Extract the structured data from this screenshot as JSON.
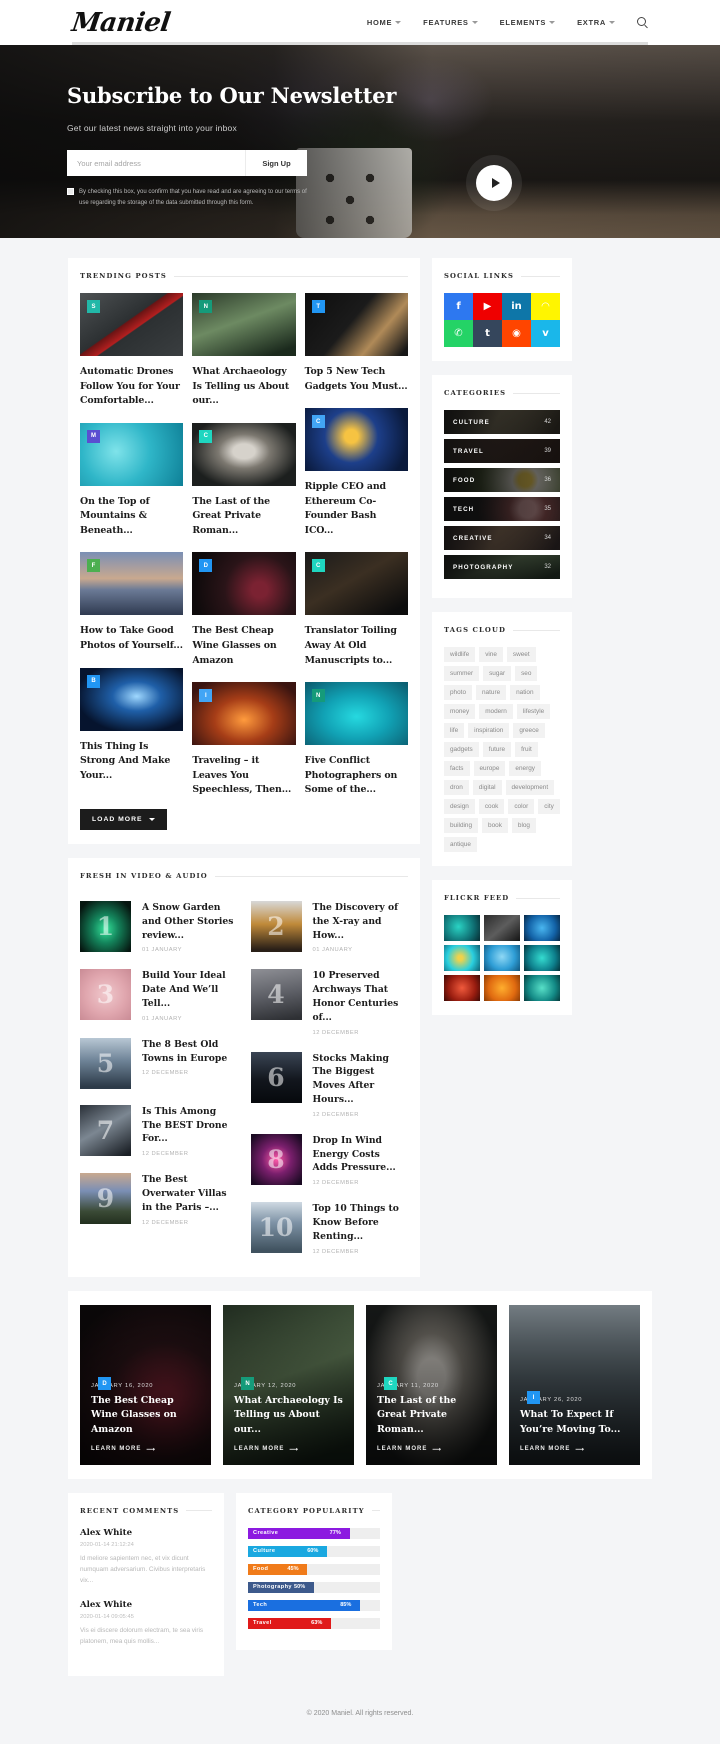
{
  "header": {
    "logo": "Maniel",
    "nav": [
      {
        "label": "HOME",
        "caret": true
      },
      {
        "label": "FEATURES",
        "caret": true
      },
      {
        "label": "ELEMENTS",
        "caret": true
      },
      {
        "label": "EXTRA",
        "caret": true
      }
    ],
    "search_icon": "search-icon"
  },
  "hero": {
    "title": "Subscribe to Our Newsletter",
    "subtitle": "Get our latest news straight into your inbox",
    "email_placeholder": "Your email address",
    "email_value": "",
    "signup_label": "Sign Up",
    "consent_text": "By checking this box, you confirm that you have read and are agreeing to our terms of use regarding the storage of the data submitted through this form.",
    "play_icon": "play-icon"
  },
  "trending": {
    "title": "TRENDING POSTS",
    "load_more": "LOAD MORE",
    "posts": [
      {
        "title": "Automatic Drones Follow You for Your Comfortable...",
        "badge": "S",
        "badge_color": "#22b8a8",
        "img": "drone"
      },
      {
        "title": "On the Top of Mountains & Beneath...",
        "badge": "M",
        "badge_color": "#5a4ed1",
        "img": "flowers"
      },
      {
        "title": "How to Take Good Photos of Yourself...",
        "badge": "F",
        "badge_color": "#4caf50",
        "img": "eiffel"
      },
      {
        "title": "This Thing Is Strong And Make Your...",
        "badge": "B",
        "badge_color": "#2196f3",
        "img": "night"
      },
      {
        "title": "What Archaeology Is Telling us About our...",
        "badge": "N",
        "badge_color": "#159b7a",
        "img": "forest"
      },
      {
        "title": "The Last of the Great Private Roman...",
        "badge": "C",
        "badge_color": "#1fd6c0",
        "img": "statue"
      },
      {
        "title": "The Best Cheap Wine Glasses on Amazon",
        "badge": "D",
        "badge_color": "#2196f3",
        "img": "wine"
      },
      {
        "title": "Traveling – it Leaves You Speechless, Then...",
        "badge": "I",
        "badge_color": "#42a5f5",
        "img": "canyon"
      },
      {
        "title": "Top 5 New Tech Gadgets You Must...",
        "badge": "T",
        "badge_color": "#2196f3",
        "img": "camera"
      },
      {
        "title": "Ripple CEO and Ethereum Co-Founder Bash ICO...",
        "badge": "C",
        "badge_color": "#42a5f5",
        "img": "bitcoin"
      },
      {
        "title": "Translator Toiling Away At Old Manuscripts to...",
        "badge": "C",
        "badge_color": "#1fd6c0",
        "img": "library"
      },
      {
        "title": "Five Conflict Photographers on Some of the...",
        "badge": "N",
        "badge_color": "#159b7a",
        "img": "gopro"
      }
    ]
  },
  "social": {
    "title": "SOCIAL LINKS",
    "items": [
      {
        "name": "facebook",
        "glyph": "f",
        "color": "#2d78f0"
      },
      {
        "name": "youtube",
        "glyph": "▶",
        "color": "#ef0000"
      },
      {
        "name": "linkedin",
        "glyph": "in",
        "color": "#0e76a8"
      },
      {
        "name": "snapchat",
        "glyph": "◠",
        "color": "#fff500"
      },
      {
        "name": "whatsapp",
        "glyph": "✆",
        "color": "#24d366"
      },
      {
        "name": "tumblr",
        "glyph": "t",
        "color": "#35465c"
      },
      {
        "name": "reddit",
        "glyph": "◉",
        "color": "#ff4500"
      },
      {
        "name": "vimeo",
        "glyph": "v",
        "color": "#1ab7ea"
      }
    ]
  },
  "categories": {
    "title": "CATEGORIES",
    "items": [
      {
        "label": "CULTURE",
        "count": "42",
        "img": "ruins"
      },
      {
        "label": "TRAVEL",
        "count": "39",
        "img": "rocks"
      },
      {
        "label": "FOOD",
        "count": "36",
        "img": "eggs"
      },
      {
        "label": "TECH",
        "count": "35",
        "img": "ball"
      },
      {
        "label": "CREATIVE",
        "count": "34",
        "img": "art"
      },
      {
        "label": "PHOTOGRAPHY",
        "count": "32",
        "img": "forest"
      }
    ]
  },
  "tags": {
    "title": "TAGS CLOUD",
    "items": [
      "wildlife",
      "vine",
      "sweet",
      "summer",
      "sugar",
      "seo",
      "photo",
      "nature",
      "nation",
      "money",
      "modern",
      "lifestyle",
      "life",
      "inspiration",
      "greece",
      "gadgets",
      "future",
      "fruit",
      "facts",
      "europe",
      "energy",
      "dron",
      "digital",
      "development",
      "design",
      "cook",
      "color",
      "city",
      "building",
      "book",
      "blog",
      "antique"
    ]
  },
  "video": {
    "title": "FRESH IN VIDEO & AUDIO",
    "items": [
      {
        "num": "1",
        "title": "A Snow Garden and Other Stories review...",
        "date": "01 JANUARY",
        "img": "aurora"
      },
      {
        "num": "2",
        "title": "The Discovery of the X-ray and How...",
        "date": "01 JANUARY",
        "img": "arcade"
      },
      {
        "num": "3",
        "title": "Build Your Ideal Date And We’ll Tell...",
        "date": "01 JANUARY",
        "img": "pink"
      },
      {
        "num": "4",
        "title": "10 Preserved Archways That Honor Centuries of...",
        "date": "12 DECEMBER",
        "img": "cathedral"
      },
      {
        "num": "5",
        "title": "The 8 Best Old Towns in Europe",
        "date": "12 DECEMBER",
        "img": "lake"
      },
      {
        "num": "6",
        "title": "Stocks Making The Biggest Moves After Hours...",
        "date": "12 DECEMBER",
        "img": "suit"
      },
      {
        "num": "7",
        "title": "Is This Among The BEST Drone For...",
        "date": "12 DECEMBER",
        "img": "drone2"
      },
      {
        "num": "8",
        "title": "Drop In Wind Energy Costs Adds Pressure...",
        "date": "12 DECEMBER",
        "img": "nebula"
      },
      {
        "num": "9",
        "title": "The Best Overwater Villas in the Paris –...",
        "date": "12 DECEMBER",
        "img": "paris"
      },
      {
        "num": "10",
        "title": "Top 10 Things to Know Before Renting...",
        "date": "12 DECEMBER",
        "img": "coast"
      }
    ]
  },
  "flickr": {
    "title": "FLICKR FEED",
    "items": [
      {
        "img": "teal-1"
      },
      {
        "img": "dark-1"
      },
      {
        "img": "blue-1"
      },
      {
        "img": "cyan-1"
      },
      {
        "img": "sky-1"
      },
      {
        "img": "aqua-1"
      },
      {
        "img": "red-1"
      },
      {
        "img": "orange-1"
      },
      {
        "img": "mint-1"
      }
    ]
  },
  "features": [
    {
      "badge": "D",
      "badge_color": "#2196f3",
      "date": "JANUARY 16, 2020",
      "title": "The Best Cheap Wine Glasses on Amazon",
      "cta": "LEARN MORE",
      "img": "wine"
    },
    {
      "badge": "N",
      "badge_color": "#159b7a",
      "date": "JANUARY 12, 2020",
      "title": "What Archaeology Is Telling us About our...",
      "cta": "LEARN MORE",
      "img": "forest"
    },
    {
      "badge": "C",
      "badge_color": "#1fd6c0",
      "date": "JANUARY 11, 2020",
      "title": "The Last of the Great Private Roman...",
      "cta": "LEARN MORE",
      "img": "statue"
    },
    {
      "badge": "I",
      "badge_color": "#2196f3",
      "date": "JANUARY 26, 2020",
      "title": "What To Expect If You’re Moving To...",
      "cta": "LEARN MORE",
      "img": "mountain"
    }
  ],
  "comments": {
    "title": "RECENT COMMENTS",
    "items": [
      {
        "name": "Alex White",
        "date": "2020-01-14 21:12:24",
        "text": "Id meliore sapientem nec, et vix dicunt numquam adversarium. Civibus interpretaris vix..."
      },
      {
        "name": "Alex White",
        "date": "2020-01-14 09:05:45",
        "text": "Vis ei discere dolorum electram, te sea viris platonem, mea quis mollis..."
      }
    ]
  },
  "popularity": {
    "title": "CATEGORY POPULARITY",
    "chart_data": {
      "type": "bar",
      "title": "CATEGORY POPULARITY",
      "categories": [
        "Creative",
        "Culture",
        "Food",
        "Photography",
        "Tech",
        "Travel"
      ],
      "values": [
        77,
        60,
        45,
        50,
        85,
        63
      ],
      "labels": [
        "77%",
        "60%",
        "45%",
        "50%",
        "85%",
        "63%"
      ],
      "colors": [
        "#8c1ae0",
        "#1aa8e0",
        "#f07b1a",
        "#3d5a8c",
        "#1a6fe0",
        "#e01a1a"
      ],
      "xlabel": "",
      "ylabel": "",
      "ylim": [
        0,
        100
      ],
      "grid": false,
      "legend": false
    }
  },
  "footer": {
    "text": "© 2020 Maniel. All rights reserved."
  }
}
